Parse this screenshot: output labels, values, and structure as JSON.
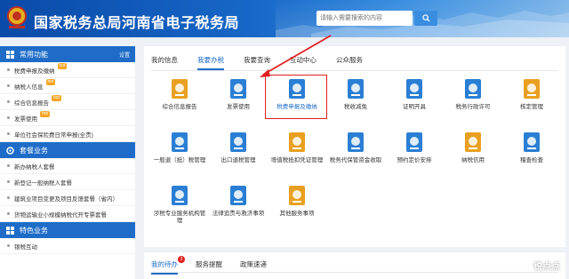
{
  "header": {
    "title": "国家税务总局河南省电子税务局",
    "search_placeholder": "请输入需要搜索的内容"
  },
  "sidebar": {
    "sections": [
      {
        "title": "常用功能",
        "action": "设置",
        "items": [
          {
            "label": "税费申报及缴纳",
            "hot": true
          },
          {
            "label": "纳税人信息",
            "hot": true
          },
          {
            "label": "综合信息报告",
            "hot": true
          },
          {
            "label": "发票使用",
            "hot": true
          },
          {
            "label": "单位社会保险费日常申报(全责)",
            "hot": false
          }
        ]
      },
      {
        "title": "套餐业务",
        "items": [
          {
            "label": "新办纳税人套餐"
          },
          {
            "label": "新登记一般纳税人套餐"
          },
          {
            "label": "建筑业项目变更及项目反馈套餐（省内）"
          },
          {
            "label": "货物运输业小规模纳税代开专票套餐"
          }
        ]
      },
      {
        "title": "特色业务",
        "items": [
          {
            "label": "银税互动"
          }
        ]
      }
    ],
    "hot_label": "hot"
  },
  "main": {
    "tabs": [
      "我的信息",
      "我要办税",
      "我要查询",
      "互动中心",
      "公众服务"
    ],
    "active_tab": 1,
    "tiles": [
      {
        "label": "综合信息报告",
        "color": "#e8a020"
      },
      {
        "label": "发票使用",
        "color": "#2a7fd4"
      },
      {
        "label": "税费申报及缴纳",
        "color": "#2a7fd4"
      },
      {
        "label": "税收减免",
        "color": "#2a7fd4"
      },
      {
        "label": "证明开具",
        "color": "#2a7fd4"
      },
      {
        "label": "税务行政许可",
        "color": "#2a7fd4"
      },
      {
        "label": "核定管理",
        "color": "#e8a020"
      },
      {
        "label": "一般退（抵）税管理",
        "color": "#2a7fd4"
      },
      {
        "label": "出口退税管理",
        "color": "#2a7fd4"
      },
      {
        "label": "增值税抵扣凭证管理",
        "color": "#e8a020"
      },
      {
        "label": "税务代保管资金收取",
        "color": "#2a7fd4"
      },
      {
        "label": "预约定价安排",
        "color": "#2a7fd4"
      },
      {
        "label": "纳税信用",
        "color": "#e8a020"
      },
      {
        "label": "稽查检查",
        "color": "#2a7fd4"
      },
      {
        "label": "涉税专业服务机构管理",
        "color": "#2a7fd4"
      },
      {
        "label": "法律追责与救济事项",
        "color": "#2a7fd4"
      },
      {
        "label": "其他服务事项",
        "color": "#e8a020"
      }
    ]
  },
  "bottom": {
    "tabs": [
      "我的待办",
      "服务提醒",
      "政策速递"
    ],
    "badge": "3"
  },
  "watermark": "锐点点"
}
